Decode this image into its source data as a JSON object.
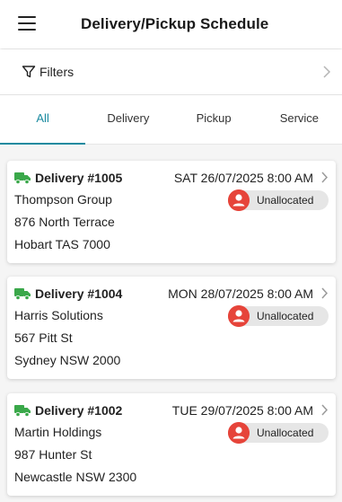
{
  "header": {
    "title": "Delivery/Pickup Schedule",
    "menu_icon": "hamburger-menu-icon"
  },
  "filters": {
    "label": "Filters",
    "icon": "funnel-icon"
  },
  "tabs": [
    {
      "label": "All",
      "active": true
    },
    {
      "label": "Delivery",
      "active": false
    },
    {
      "label": "Pickup",
      "active": false
    },
    {
      "label": "Service",
      "active": false
    }
  ],
  "colors": {
    "accent": "#1a8aa0",
    "truck": "#3aa84a",
    "unallocated_avatar": "#e6443a",
    "badge_bg": "#e6e6e6"
  },
  "cards": [
    {
      "title": "Delivery #1005",
      "date": "SAT 26/07/2025 8:00 AM",
      "company": "Thompson Group",
      "street": "876 North Terrace",
      "city": "Hobart TAS 7000",
      "status": "Unallocated"
    },
    {
      "title": "Delivery #1004",
      "date": "MON 28/07/2025 8:00 AM",
      "company": "Harris Solutions",
      "street": "567 Pitt St",
      "city": "Sydney NSW 2000",
      "status": "Unallocated"
    },
    {
      "title": "Delivery #1002",
      "date": "TUE 29/07/2025 8:00 AM",
      "company": "Martin Holdings",
      "street": "987 Hunter St",
      "city": "Newcastle NSW 2300",
      "status": "Unallocated"
    }
  ]
}
